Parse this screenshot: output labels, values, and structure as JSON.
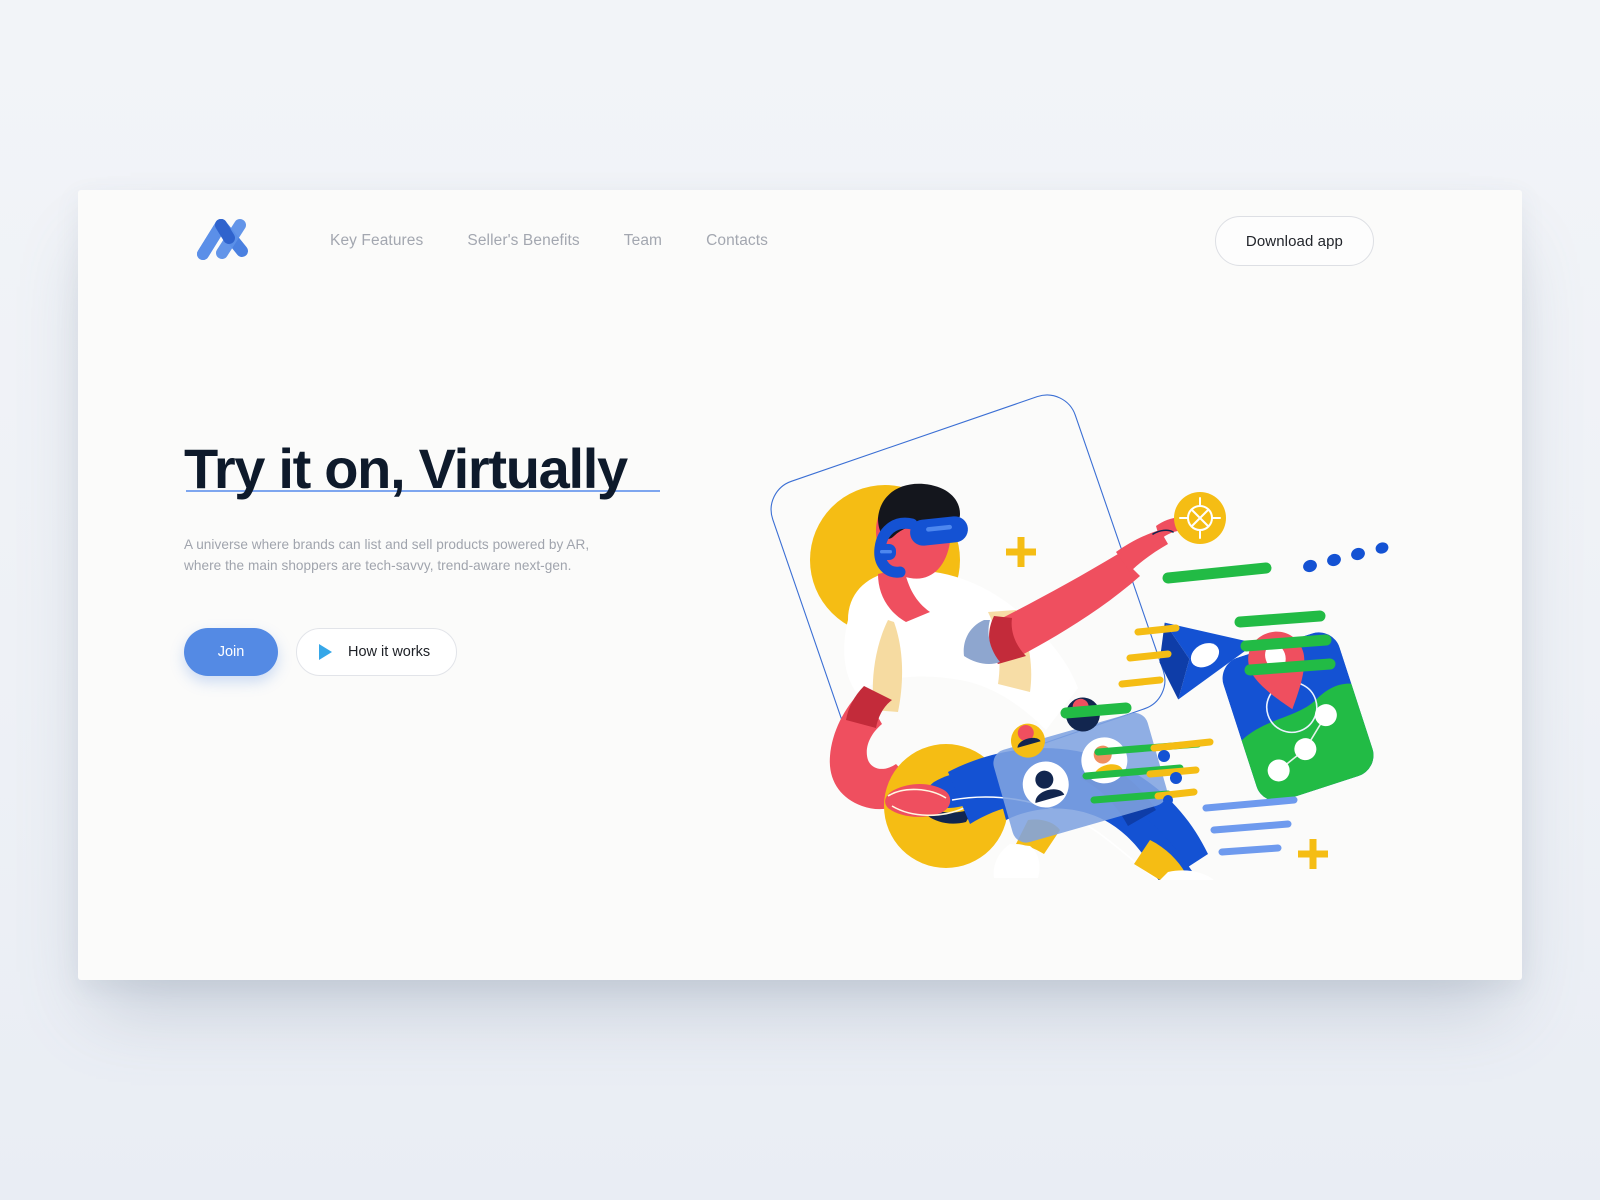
{
  "page": {
    "background_color": "#f2f4f8",
    "card_color": "#fbfbfa"
  },
  "header": {
    "logo_name": "brand-logo-n",
    "nav": [
      {
        "label": "Key Features"
      },
      {
        "label": "Seller's Benefits"
      },
      {
        "label": "Team"
      },
      {
        "label": "Contacts"
      }
    ],
    "download_label": "Download app"
  },
  "hero": {
    "headline": "Try it on, Virtually",
    "headline_underline_color": "#7ea6ef",
    "subcopy": "A universe where brands can list and sell products powered by AR, where the main shoppers are tech-savvy, trend-aware next-gen.",
    "primary_cta": "Join",
    "secondary_cta": "How it works",
    "primary_cta_color": "#548ae4",
    "play_icon_color": "#36a7e8"
  },
  "illustration": {
    "name": "vr-shopper-illustration",
    "colors": {
      "yellow": "#f5bd14",
      "blue": "#1452d3",
      "coral": "#ef4f5f",
      "green": "#22bb45",
      "navy": "#12264f",
      "skin_shadow": "#8ea6cf",
      "sand": "#f6d99c",
      "outline": "#3b6fd4"
    },
    "elements": [
      {
        "name": "rotated-frame-outline"
      },
      {
        "name": "yellow-halo-circle"
      },
      {
        "name": "character-head-vr-headset"
      },
      {
        "name": "pointing-arm"
      },
      {
        "name": "compass-badge-icon"
      },
      {
        "name": "yellow-hand-circle"
      },
      {
        "name": "avatar-card"
      },
      {
        "name": "paper-plane-icon"
      },
      {
        "name": "map-card-with-pin"
      },
      {
        "name": "location-pin-icon"
      },
      {
        "name": "plus-marks"
      },
      {
        "name": "speed-lines"
      },
      {
        "name": "dot-trail"
      }
    ]
  }
}
